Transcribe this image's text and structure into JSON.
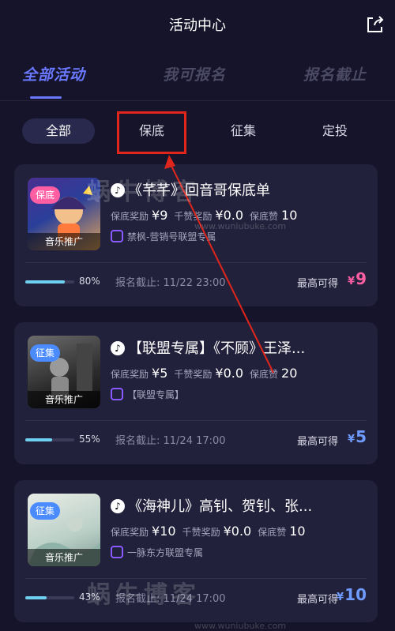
{
  "header": {
    "title": "活动中心",
    "share_icon": "share-icon"
  },
  "tabs": [
    {
      "label": "全部活动",
      "active": true
    },
    {
      "label": "我可报名",
      "active": false
    },
    {
      "label": "报名截止",
      "active": false
    }
  ],
  "filters": [
    {
      "label": "全部",
      "active": true
    },
    {
      "label": "保底",
      "active": false
    },
    {
      "label": "征集",
      "active": false
    },
    {
      "label": "定投",
      "active": false
    }
  ],
  "cards": [
    {
      "badge": "保底",
      "cover_label": "音乐推广",
      "title": "《芊芊》回音哥保底单",
      "stats": {
        "guarantee_label": "保底奖励",
        "guarantee_value": "¥9",
        "like_label": "千赞奖励",
        "like_value": "¥0.0",
        "min_likes_label": "保底赞",
        "min_likes_value": "10"
      },
      "union": "禁枫-营销号联盟专属",
      "progress_text": "80%",
      "progress_fraction": 0.8,
      "deadline": "报名截止: 11/22 23:00",
      "max_label": "最高可得",
      "max_currency": "¥",
      "max_value": "9",
      "max_color": "#ff5ea3"
    },
    {
      "badge": "征集",
      "cover_label": "音乐推广",
      "title": "【联盟专属】《不顾》王泽...",
      "stats": {
        "guarantee_label": "保底奖励",
        "guarantee_value": "¥5",
        "like_label": "千赞奖励",
        "like_value": "¥0.0",
        "min_likes_label": "保底赞",
        "min_likes_value": "20"
      },
      "union": "【联盟专属】",
      "progress_text": "55%",
      "progress_fraction": 0.55,
      "deadline": "报名截止: 11/24 17:00",
      "max_label": "最高可得",
      "max_currency": "¥",
      "max_value": "5",
      "max_color": "#6f9bff"
    },
    {
      "badge": "征集",
      "cover_label": "音乐推广",
      "title": "《海神儿》高钊、贺钊、张...",
      "stats": {
        "guarantee_label": "保底奖励",
        "guarantee_value": "¥10",
        "like_label": "千赞奖励",
        "like_value": "¥0.0",
        "min_likes_label": "保底赞",
        "min_likes_value": "10"
      },
      "union": "一脉东方联盟专属",
      "progress_text": "43%",
      "progress_fraction": 0.43,
      "deadline": "报名截止: 11/24 17:00",
      "max_label": "最高可得",
      "max_currency": "¥",
      "max_value": "10",
      "max_color": "#6f9bff"
    }
  ],
  "watermark": {
    "text": "蜗牛博客",
    "url": "www.wuniubuke.com"
  },
  "colors": {
    "background": "#15142a",
    "card": "#22213b",
    "accent": "#6a78ff",
    "highlight": "#e0261c",
    "pink": "#ff5ea3",
    "blue": "#6f9bff"
  }
}
